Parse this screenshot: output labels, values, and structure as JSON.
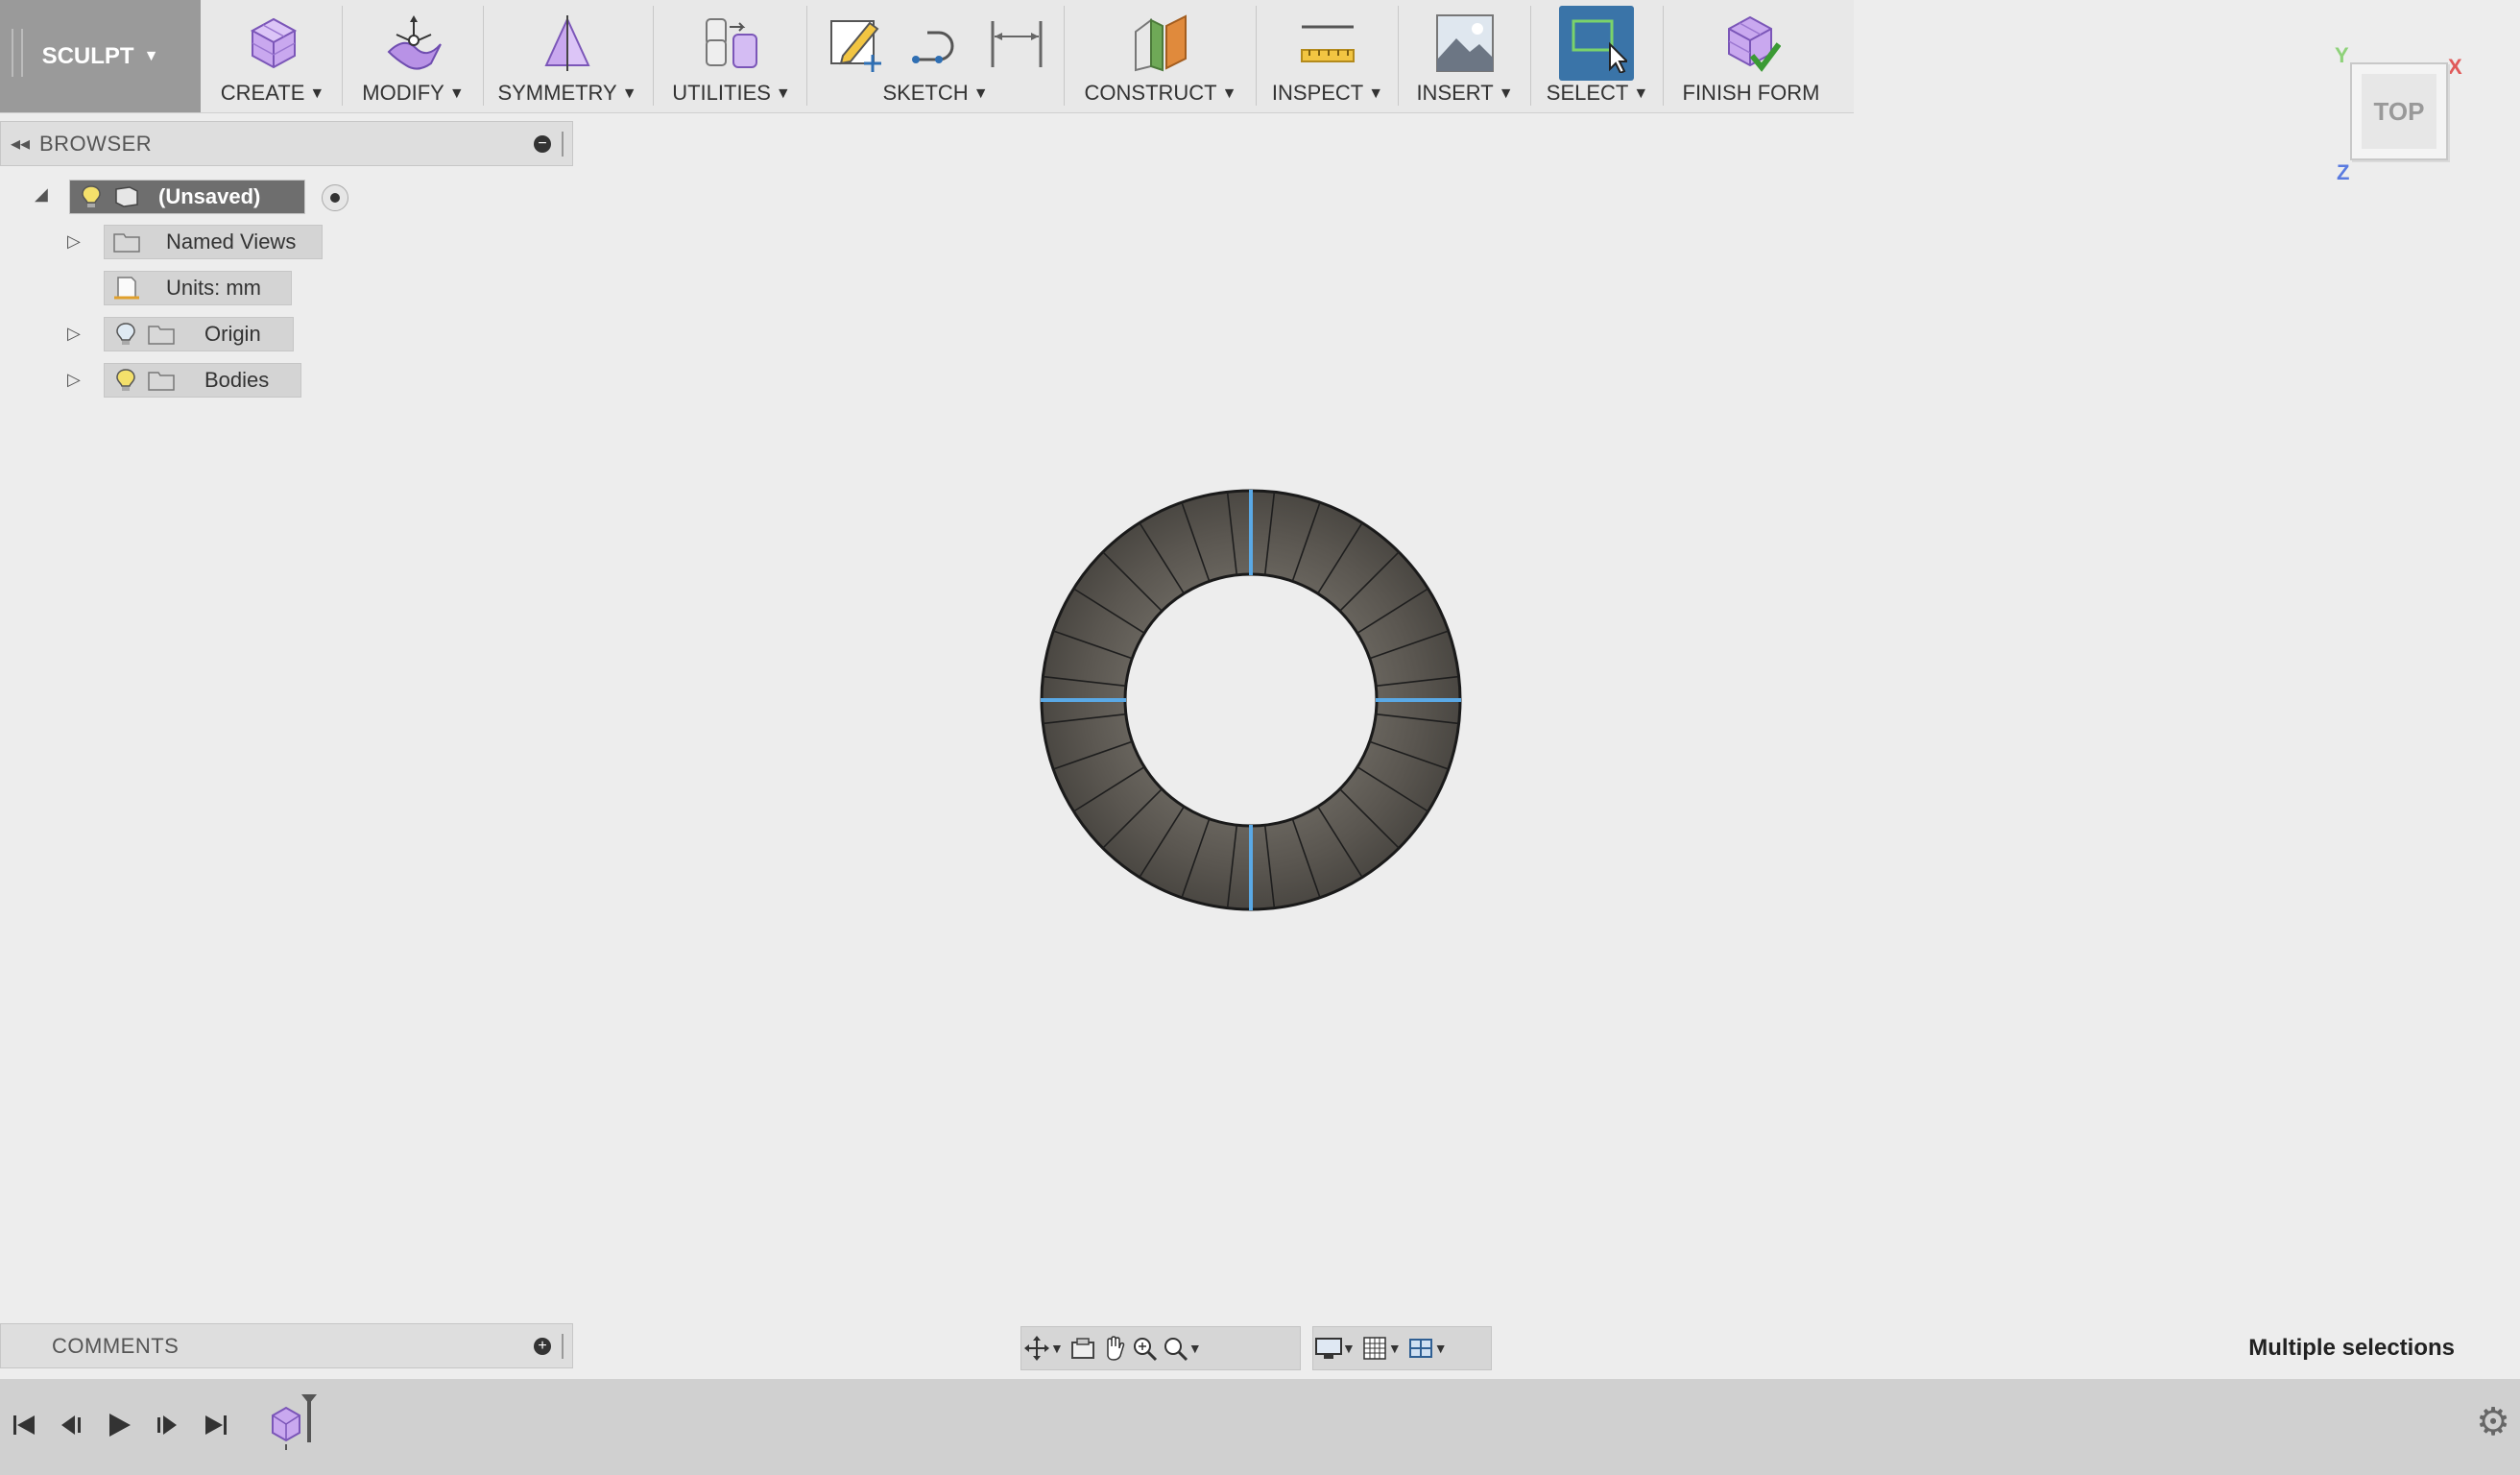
{
  "toolbar": {
    "workspace": "SCULPT",
    "groups": {
      "create": "CREATE",
      "modify": "MODIFY",
      "symmetry": "SYMMETRY",
      "utilities": "UTILITIES",
      "sketch": "SKETCH",
      "construct": "CONSTRUCT",
      "inspect": "INSPECT",
      "insert": "INSERT",
      "select": "SELECT",
      "finish": "FINISH FORM"
    }
  },
  "browser": {
    "title": "BROWSER",
    "root": "(Unsaved)",
    "items": [
      {
        "label": "Named Views"
      },
      {
        "label": "Units: mm"
      },
      {
        "label": "Origin"
      },
      {
        "label": "Bodies"
      }
    ]
  },
  "viewcube": {
    "face": "TOP",
    "axis_x": "X",
    "axis_y": "Y",
    "axis_z": "Z"
  },
  "comments": {
    "title": "COMMENTS"
  },
  "status": {
    "text": "Multiple selections"
  },
  "colors": {
    "accent_select": "#3a74a8",
    "body_fill": "#5e5a55",
    "selected_edge": "#5aa9e6",
    "create_icon": "#b38be0",
    "construct_orange": "#e08a3c"
  },
  "icons": [
    "create-box-icon",
    "modify-icon",
    "symmetry-icon",
    "utilities-icon",
    "create-sketch-icon",
    "sketch-arc-icon",
    "sketch-dimension-icon",
    "construct-plane-icon",
    "measure-icon",
    "insert-image-icon",
    "select-window-icon",
    "finish-form-icon",
    "gear-icon"
  ]
}
